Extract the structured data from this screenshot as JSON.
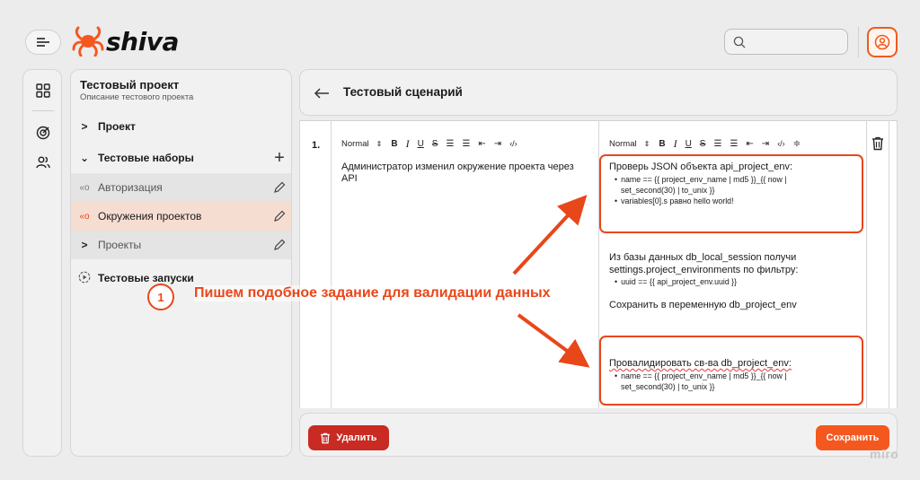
{
  "app": {
    "logo_text": "shiva"
  },
  "search": {
    "placeholder": ""
  },
  "colors": {
    "accent": "#f4581f",
    "danger": "#c92a22",
    "highlight": "#e8471a",
    "selected_row": "#f6ddd2"
  },
  "rail": {
    "icons": [
      "grid-icon",
      "target-icon",
      "users-icon"
    ]
  },
  "project": {
    "title": "Тестовый проект",
    "description": "Описание тестового проекта",
    "tree": [
      {
        "label": "Проект",
        "arrow": ">",
        "bold": true
      },
      {
        "label": "Тестовые наборы",
        "arrow": "⌄",
        "bold": true,
        "action": "+"
      },
      {
        "label": "Авторизация",
        "prefix": "«o"
      },
      {
        "label": "Окружения проектов",
        "prefix": "«o",
        "selected": true
      },
      {
        "label": "Проекты",
        "arrow": ">"
      },
      {
        "label": "Тестовые запуски",
        "bold": true
      }
    ]
  },
  "scenario": {
    "title": "Тестовый сценарий",
    "step": {
      "number": "1.",
      "toolbar_style": "Normal",
      "action": "Администратор изменил окружение проекта через API",
      "expected": {
        "block1": {
          "heading": "Проверь JSON объекта api_project_env:",
          "items": [
            {
              "line1": "name == {{ project_env_name | md5 }}_{{ now |",
              "line2": "set_second(30) | to_unix }}"
            },
            {
              "line1": "variables[0].s равно hello world!",
              "line2": ""
            }
          ]
        },
        "block2": {
          "line1": "Из базы данных db_local_session получи",
          "line2": "settings.project_environments по фильтру:",
          "item": "uuid == {{ api_project_env.uuid }}",
          "save": "Сохранить в переменную db_project_env"
        },
        "block3": {
          "heading": "Провалидировать св-ва db_project_env:",
          "items": [
            {
              "line1": "name == {{ project_env_name | md5 }}_{{ now |",
              "line2": "set_second(30) | to_unix }}"
            }
          ]
        }
      }
    }
  },
  "footer": {
    "delete_label": "Удалить",
    "save_label": "Сохранить"
  },
  "annotation": {
    "number": "1",
    "text": "Пишем подобное задание для валидации данных"
  },
  "watermark": "miro"
}
